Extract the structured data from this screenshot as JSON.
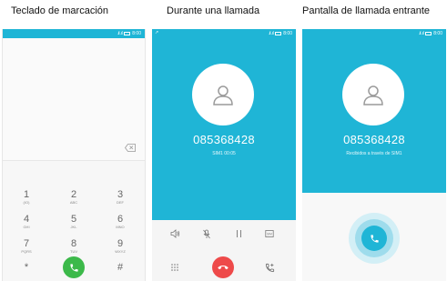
{
  "captions": {
    "dialer": "Teclado de marcación",
    "in_call": "Durante una llamada",
    "incoming": "Pantalla de llamada entrante"
  },
  "status": {
    "time": "8:00"
  },
  "keypad": [
    {
      "digit": "1",
      "letters": "(IO)"
    },
    {
      "digit": "2",
      "letters": "ABC"
    },
    {
      "digit": "3",
      "letters": "DEF"
    },
    {
      "digit": "4",
      "letters": "GHI"
    },
    {
      "digit": "5",
      "letters": "JKL"
    },
    {
      "digit": "6",
      "letters": "MNO"
    },
    {
      "digit": "7",
      "letters": "PQRS"
    },
    {
      "digit": "8",
      "letters": "TUV"
    },
    {
      "digit": "9",
      "letters": "WXYZ"
    },
    {
      "digit": "*",
      "letters": ""
    },
    {
      "digit": "0",
      "letters": "+"
    },
    {
      "digit": "#",
      "letters": ""
    }
  ],
  "in_call": {
    "number": "085368428",
    "sub": "SIM1  00:05"
  },
  "incoming": {
    "number": "085368428",
    "sub": "Recibidos a través de  SIM1"
  },
  "icons": {
    "call": "phone-icon",
    "hangup": "phone-hangup-icon",
    "speaker": "speaker-icon",
    "mute": "microphone-icon",
    "hold": "pause-icon",
    "sim": "sim-card-icon",
    "dialpad": "dialpad-icon",
    "add_call": "add-call-icon",
    "backspace": "backspace-icon",
    "contact": "person-icon"
  },
  "colors": {
    "accent": "#1fb5d6",
    "call_green": "#3cb94a",
    "hangup_red": "#ee4a4a"
  }
}
